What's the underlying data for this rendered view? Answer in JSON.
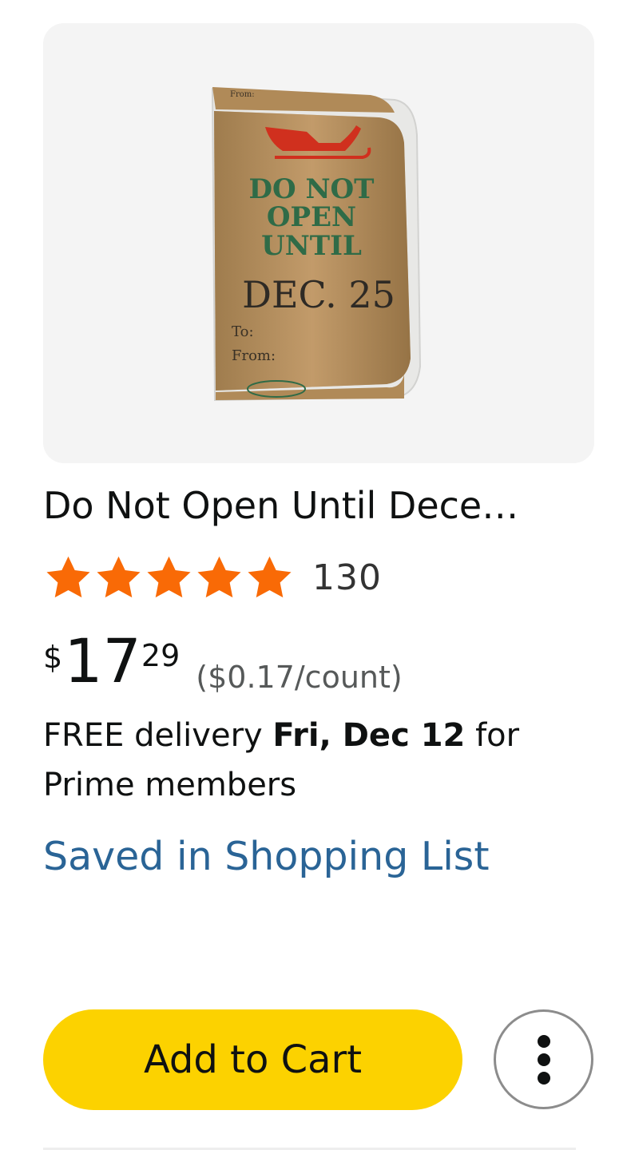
{
  "product": {
    "image_alt_text_lines": [
      "DO NOT",
      "OPEN",
      "UNTIL",
      "DEC. 25",
      "To:",
      "From:",
      "From:"
    ],
    "title": "Do Not Open Until Dece…",
    "rating": {
      "stars": 5,
      "review_count": "130"
    },
    "price": {
      "symbol": "$",
      "whole": "17",
      "fraction": "29",
      "unit_price": "($0.17/count)"
    },
    "delivery": {
      "prefix": "FREE delivery ",
      "date": "Fri, Dec 12",
      "suffix": " for Prime members"
    },
    "saved_link": "Saved in Shopping List",
    "add_to_cart": "Add to Cart"
  },
  "colors": {
    "star": "#f96a06",
    "button": "#fcd200",
    "link": "#2a6496"
  },
  "icons": {
    "more": "vertical-ellipsis-icon",
    "star": "star-icon"
  }
}
